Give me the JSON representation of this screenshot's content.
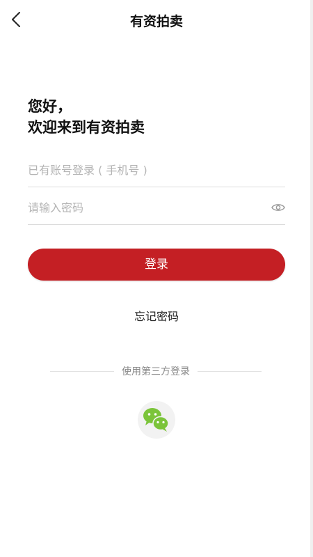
{
  "header": {
    "title": "有资拍卖",
    "back_icon": "chevron-left-icon"
  },
  "greeting": {
    "line1": "您好，",
    "line2": "欢迎来到有资拍卖"
  },
  "form": {
    "account_placeholder": "已有账号登录 ( 手机号 )",
    "account_value": "",
    "password_placeholder": "请输入密码",
    "password_value": "",
    "password_toggle_icon": "eye-icon"
  },
  "actions": {
    "login_label": "登录",
    "forgot_label": "忘记密码"
  },
  "third_party": {
    "divider_label": "使用第三方登录",
    "providers": [
      {
        "name": "wechat",
        "icon": "wechat-icon",
        "color": "#7bc43a"
      }
    ]
  },
  "colors": {
    "primary": "#c41f24",
    "wechat": "#7bc43a"
  }
}
